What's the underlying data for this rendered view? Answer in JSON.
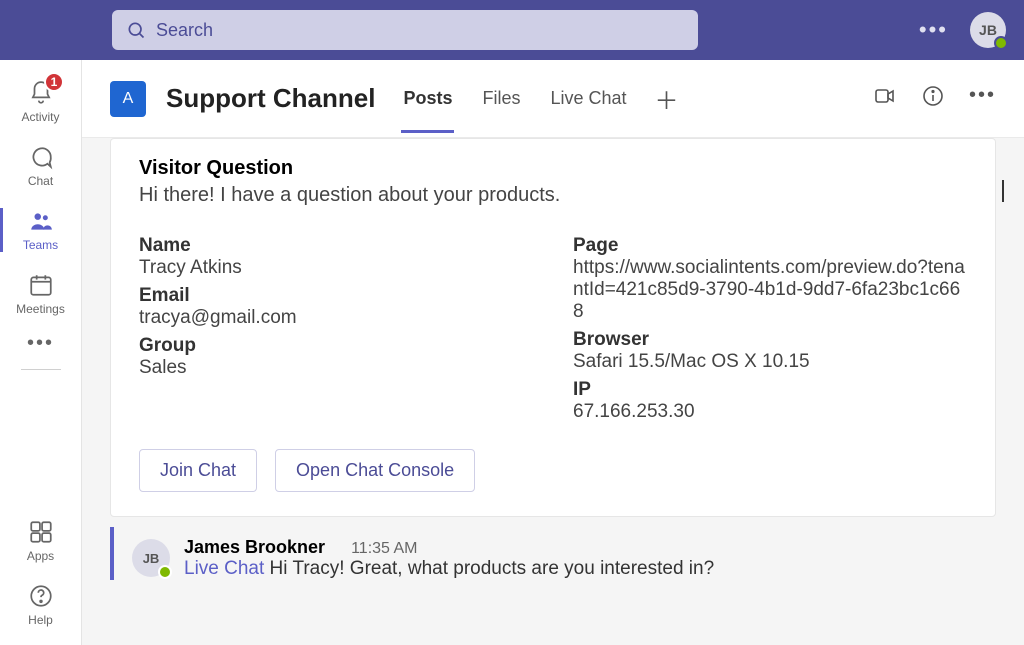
{
  "topbar": {
    "search_placeholder": "Search",
    "avatar_initials": "JB"
  },
  "rail": {
    "activity": {
      "label": "Activity",
      "badge": "1"
    },
    "chat": {
      "label": "Chat"
    },
    "teams": {
      "label": "Teams"
    },
    "meetings": {
      "label": "Meetings"
    },
    "apps": {
      "label": "Apps"
    },
    "help": {
      "label": "Help"
    }
  },
  "channel": {
    "tile_letter": "A",
    "title": "Support Channel",
    "tabs": {
      "posts": "Posts",
      "files": "Files",
      "livechat": "Live Chat"
    }
  },
  "card": {
    "heading": "Visitor Question",
    "question": "Hi there! I have a question about your products.",
    "left": {
      "name_label": "Name",
      "name": "Tracy Atkins",
      "email_label": "Email",
      "email": "tracya@gmail.com",
      "group_label": "Group",
      "group": "Sales"
    },
    "right": {
      "page_label": "Page",
      "page": "https://www.socialintents.com/preview.do?tenantId=421c85d9-3790-4b1d-9dd7-6fa23bc1c668",
      "browser_label": "Browser",
      "browser": "Safari 15.5/Mac OS X 10.15",
      "ip_label": "IP",
      "ip": "67.166.253.30"
    },
    "actions": {
      "join": "Join Chat",
      "console": "Open Chat Console"
    }
  },
  "reply": {
    "avatar": "JB",
    "name": "James Brookner",
    "time": "11:35 AM",
    "tag": "Live Chat",
    "text": " Hi Tracy!  Great, what products are you interested in?"
  }
}
